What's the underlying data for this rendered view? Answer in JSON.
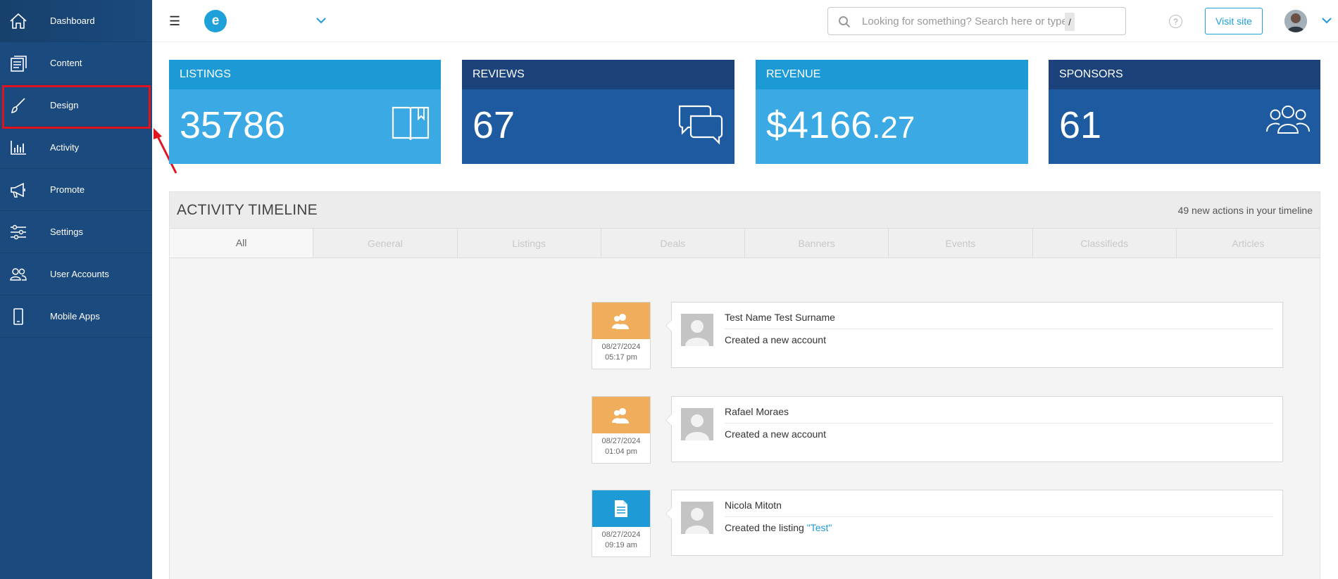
{
  "sidebar": {
    "items": [
      {
        "label": "Dashboard",
        "icon": "home-icon"
      },
      {
        "label": "Content",
        "icon": "content-icon"
      },
      {
        "label": "Design",
        "icon": "brush-icon"
      },
      {
        "label": "Activity",
        "icon": "bar-chart-icon"
      },
      {
        "label": "Promote",
        "icon": "megaphone-icon"
      },
      {
        "label": "Settings",
        "icon": "sliders-icon"
      },
      {
        "label": "User Accounts",
        "icon": "users-icon"
      },
      {
        "label": "Mobile Apps",
        "icon": "mobile-icon"
      }
    ]
  },
  "header": {
    "logo_letter": "e",
    "search_placeholder": "Looking for something? Search here or type",
    "search_shortcut": "/",
    "help_label": "?",
    "visit_label": "Visit site"
  },
  "stats": [
    {
      "title": "LISTINGS",
      "value": "35786",
      "icon": "book-icon"
    },
    {
      "title": "REVIEWS",
      "value": "67",
      "icon": "chat-bubbles-icon"
    },
    {
      "title": "REVENUE",
      "value": "$4166",
      "cents": ".27",
      "icon": "none"
    },
    {
      "title": "SPONSORS",
      "value": "61",
      "icon": "group-icon"
    }
  ],
  "timeline": {
    "title": "ACTIVITY TIMELINE",
    "subtitle": "49 new actions in your timeline",
    "tabs": [
      "All",
      "General",
      "Listings",
      "Deals",
      "Banners",
      "Events",
      "Classifieds",
      "Articles"
    ],
    "active_tab": "All",
    "entries": [
      {
        "date": "08/27/2024",
        "time": "05:17 pm",
        "name": "Test Name Test Surname",
        "action": "Created a new account",
        "kind": "account"
      },
      {
        "date": "08/27/2024",
        "time": "01:04 pm",
        "name": "Rafael Moraes",
        "action": "Created a new account",
        "kind": "account"
      },
      {
        "date": "08/27/2024",
        "time": "09:19 am",
        "name": "Nicola Mitotn",
        "action": "Created the listing ",
        "link": "\"Test\"",
        "kind": "listing"
      }
    ]
  },
  "colors": {
    "sidebar_bg": "#1a4a7e",
    "tile_light": "#3ba9e4",
    "tile_dark": "#1e5aa0",
    "accent": "#1ea0d8",
    "highlight": "#e0141e",
    "timeline_account": "#f0ad5c"
  }
}
